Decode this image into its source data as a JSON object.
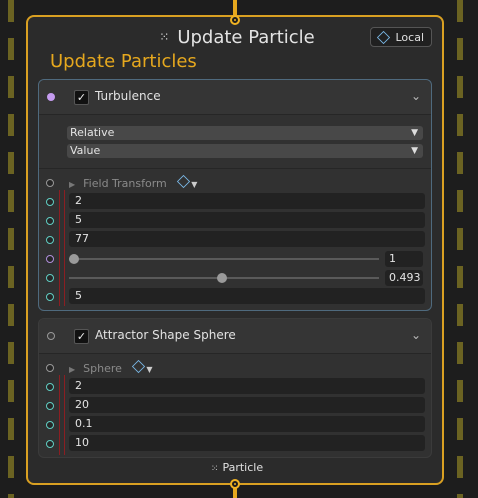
{
  "node": {
    "title": "Update Particle",
    "title_icon": "particle-dots-icon",
    "local_label": "Local",
    "subtitle": "Update Particles",
    "footer_label": "Particle"
  },
  "turbulence": {
    "label": "Turbulence",
    "enabled": true,
    "dropdown1": "Relative",
    "dropdown2": "Value",
    "section_label": "Field Transform",
    "values": [
      "2",
      "5",
      "77"
    ],
    "slider1_value": "1",
    "slider1_fraction": 0.0,
    "slider2_value": "0.493",
    "slider2_fraction": 0.493,
    "last_value": "5"
  },
  "attractor": {
    "label": "Attractor Shape Sphere",
    "enabled": true,
    "section_label": "Sphere",
    "values": [
      "2",
      "20",
      "0.1",
      "10"
    ]
  },
  "colors": {
    "accent": "#e6a81e",
    "node_bg": "#2b2b2b",
    "socket_teal": "#60cfc4",
    "socket_purple": "#c59cf0",
    "selection_border": "#4f6a7e"
  }
}
